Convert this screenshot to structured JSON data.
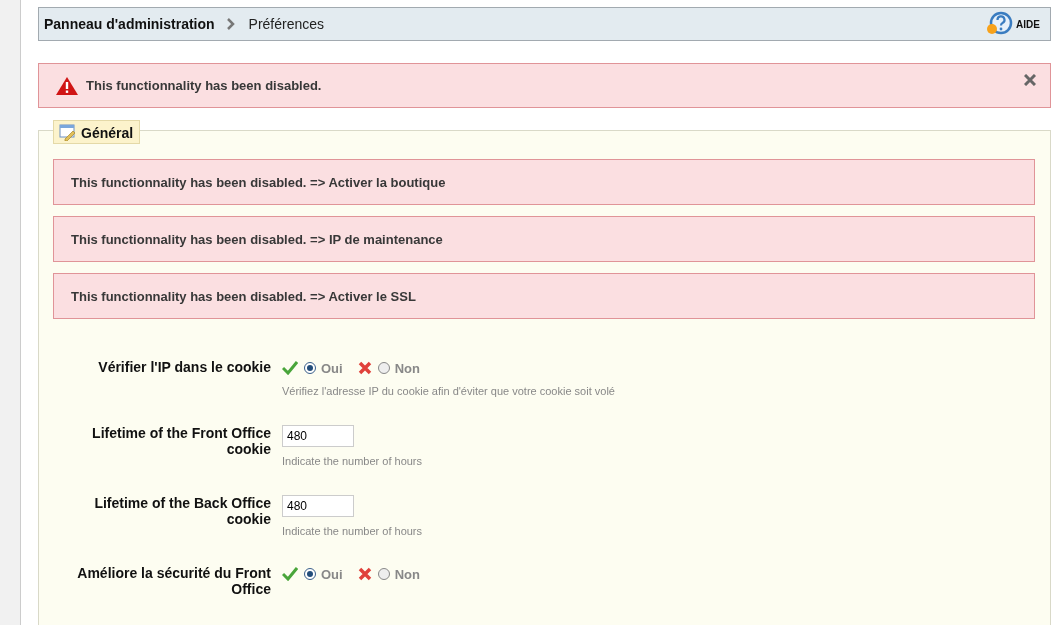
{
  "breadcrumb": {
    "items": [
      "Panneau d'administration",
      "Préférences"
    ],
    "help": "AIDE"
  },
  "alert": {
    "message": "This functionnality has been disabled."
  },
  "section": {
    "title": "Général",
    "alerts": [
      "This functionnality has been disabled. => Activer la boutique",
      "This functionnality has been disabled. => IP de maintenance",
      "This functionnality has been disabled. => Activer le SSL"
    ],
    "fields": [
      {
        "kind": "radio",
        "label": "Vérifier l'IP dans le cookie",
        "options": [
          {
            "label": "Oui",
            "selected": true
          },
          {
            "label": "Non",
            "selected": false
          }
        ],
        "hint": "Vérifiez l'adresse IP du cookie afin d'éviter que votre cookie soit volé"
      },
      {
        "kind": "text",
        "label": "Lifetime of the Front Office cookie",
        "value": "480",
        "hint": "Indicate the number of hours"
      },
      {
        "kind": "text",
        "label": "Lifetime of the Back Office cookie",
        "value": "480",
        "hint": "Indicate the number of hours"
      },
      {
        "kind": "radio",
        "label": "Améliore la sécurité du Front Office",
        "options": [
          {
            "label": "Oui",
            "selected": true
          },
          {
            "label": "Non",
            "selected": false
          }
        ]
      }
    ]
  }
}
